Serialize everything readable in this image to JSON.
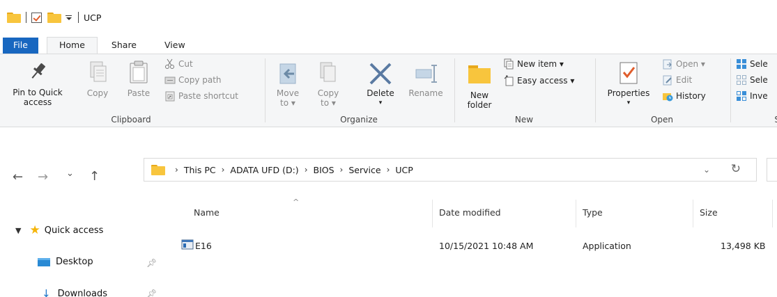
{
  "window": {
    "title": "UCP"
  },
  "tabs": {
    "file": "File",
    "home": "Home",
    "share": "Share",
    "view": "View"
  },
  "ribbon": {
    "clipboard": {
      "label": "Clipboard",
      "pin_line1": "Pin to Quick",
      "pin_line2": "access",
      "copy": "Copy",
      "paste": "Paste",
      "cut": "Cut",
      "copy_path": "Copy path",
      "paste_shortcut": "Paste shortcut"
    },
    "organize": {
      "label": "Organize",
      "move_to_line1": "Move",
      "move_to_line2": "to ▾",
      "copy_to_line1": "Copy",
      "copy_to_line2": "to ▾",
      "delete": "Delete",
      "delete_arrow": "▾",
      "rename": "Rename"
    },
    "new": {
      "label": "New",
      "new_folder_line1": "New",
      "new_folder_line2": "folder",
      "new_item": "New item ▾",
      "easy_access": "Easy access ▾"
    },
    "open": {
      "label": "Open",
      "properties": "Properties",
      "properties_arrow": "▾",
      "open": "Open ▾",
      "edit": "Edit",
      "history": "History"
    },
    "select": {
      "label": "S",
      "select_all": "Sele",
      "select_none": "Sele",
      "invert": "Inve"
    }
  },
  "address_bar": {
    "crumbs": [
      "This PC",
      "ADATA UFD (D:)",
      "BIOS",
      "Service",
      "UCP"
    ],
    "separator": "›",
    "dropdown": "⌄",
    "refresh": "↻"
  },
  "nav_buttons": {
    "back": "←",
    "forward": "→",
    "recent": "⌄",
    "up": "↑"
  },
  "columns": {
    "name": "Name",
    "date_modified": "Date modified",
    "type": "Type",
    "size": "Size",
    "sort_indicator": "^"
  },
  "files": [
    {
      "name": "E16",
      "date_modified": "10/15/2021 10:48 AM",
      "type": "Application",
      "size": "13,498 KB"
    }
  ],
  "nav_pane": {
    "quick_access": "Quick access",
    "items": [
      {
        "label": "Desktop",
        "pinned": true
      },
      {
        "label": "Downloads",
        "pinned": true
      }
    ]
  },
  "colors": {
    "file_tab": "#1867c0",
    "folder": "#f8c53d",
    "star": "#f5b50a",
    "accent_blue": "#1a73c8"
  }
}
